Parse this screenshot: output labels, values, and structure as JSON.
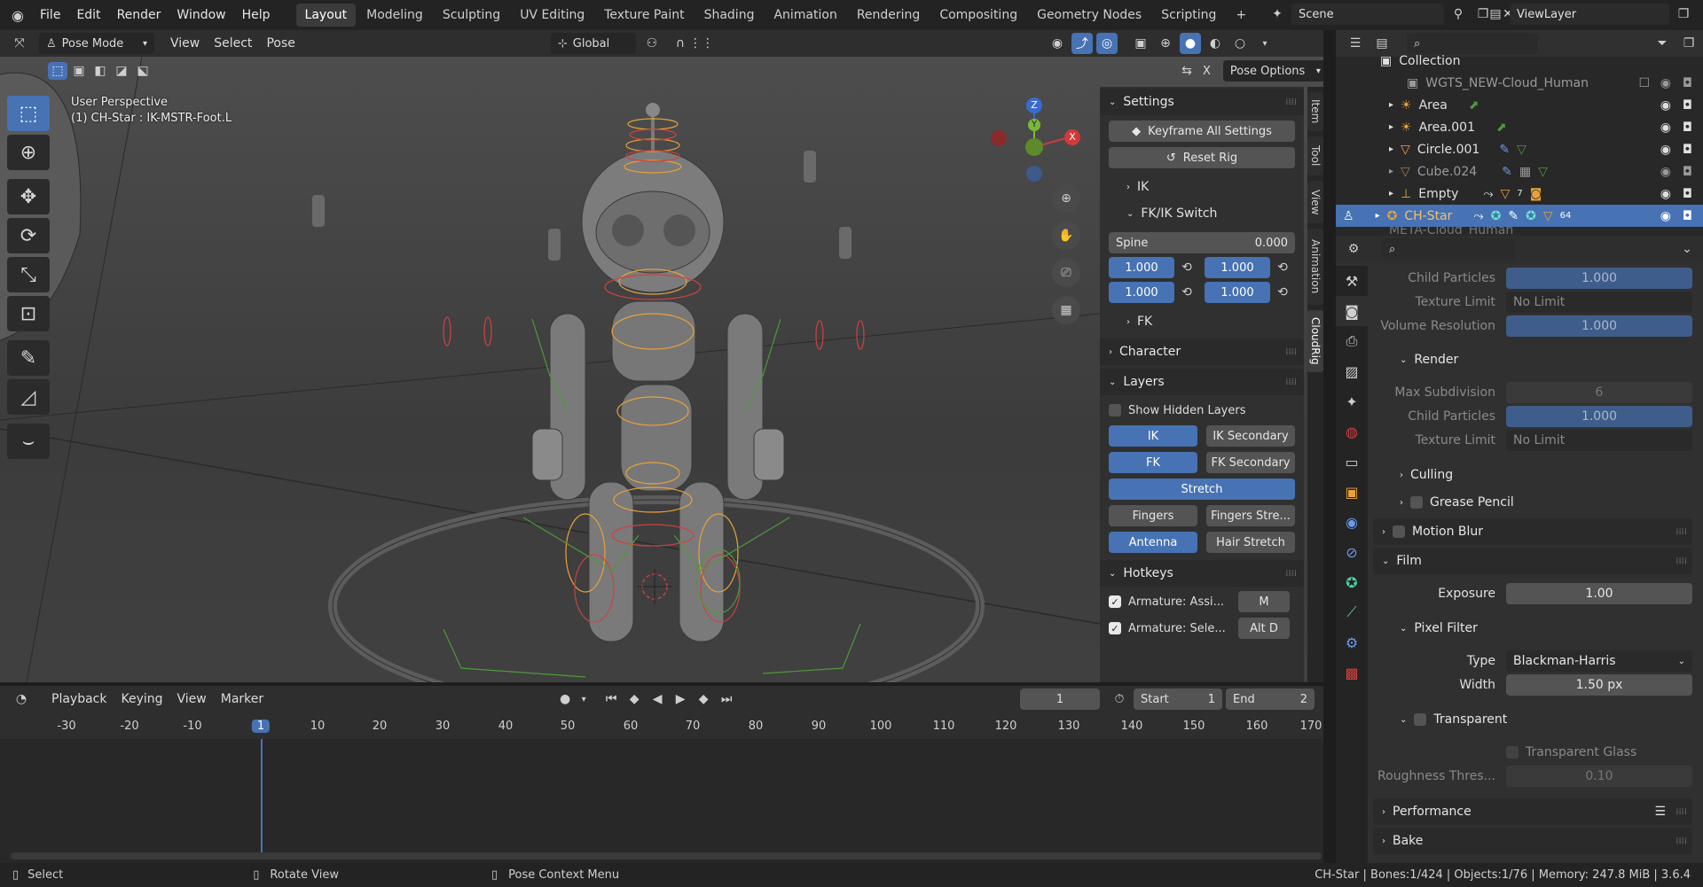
{
  "menu": [
    "File",
    "Edit",
    "Render",
    "Window",
    "Help"
  ],
  "workspaces": [
    "Layout",
    "Modeling",
    "Sculpting",
    "UV Editing",
    "Texture Paint",
    "Shading",
    "Animation",
    "Rendering",
    "Compositing",
    "Geometry Nodes",
    "Scripting"
  ],
  "active_workspace": "Layout",
  "scene": "Scene",
  "view_layer": "ViewLayer",
  "viewport_header": {
    "mode": "Pose Mode",
    "menus": [
      "View",
      "Select",
      "Pose"
    ],
    "orientation": "Global",
    "pose_options": "Pose Options",
    "x_label": "X"
  },
  "overlay_text": {
    "perspective": "User Perspective",
    "object": "(1) CH-Star : IK-MSTR-Foot.L"
  },
  "gizmo_axes": {
    "z": "Z",
    "y": "Y",
    "x": "X"
  },
  "npanel": {
    "settings_title": "Settings",
    "keyframe_all": "Keyframe All Settings",
    "reset_rig": "Reset Rig",
    "ik": "IK",
    "fkik_switch": "FK/IK Switch",
    "spine_label": "Spine",
    "spine_value": "0.000",
    "switch_values": [
      "1.000",
      "1.000",
      "1.000",
      "1.000"
    ],
    "fk": "FK",
    "character": "Character",
    "layers_title": "Layers",
    "show_hidden": "Show Hidden Layers",
    "layer_buttons": [
      {
        "label": "IK",
        "on": true
      },
      {
        "label": "IK Secondary",
        "on": false
      },
      {
        "label": "FK",
        "on": true
      },
      {
        "label": "FK Secondary",
        "on": false
      },
      {
        "label": "Stretch",
        "on": true
      },
      {
        "label": "Fingers",
        "on": false
      },
      {
        "label": "Fingers Stre...",
        "on": false
      },
      {
        "label": "Antenna",
        "on": true
      },
      {
        "label": "Hair Stretch",
        "on": false
      }
    ],
    "hotkeys_title": "Hotkeys",
    "hotkeys": [
      {
        "label": "Armature: Assi...",
        "key": "M"
      },
      {
        "label": "Armature: Sele...",
        "key": "Alt D"
      }
    ]
  },
  "vertical_tabs": [
    "Item",
    "Tool",
    "View",
    "Animation",
    "CloudRig"
  ],
  "timeline": {
    "menus": [
      "Playback",
      "Keying",
      "View",
      "Marker"
    ],
    "current_frame": "1",
    "start_label": "Start",
    "start": "1",
    "end_label": "End",
    "end": "2",
    "ticks": [
      "-30",
      "-20",
      "-10",
      "1",
      "10",
      "20",
      "30",
      "40",
      "50",
      "60",
      "70",
      "80",
      "90",
      "100",
      "110",
      "120",
      "130",
      "140",
      "150",
      "160",
      "170"
    ]
  },
  "outliner": {
    "rows": [
      {
        "name": "Collection",
        "icon": "collection-icon"
      },
      {
        "name": "WGTS_NEW-Cloud_Human",
        "icon": "collection-icon"
      },
      {
        "name": "Area",
        "icon": "light-icon"
      },
      {
        "name": "Area.001",
        "icon": "light-icon"
      },
      {
        "name": "Circle.001",
        "icon": "mesh-icon"
      },
      {
        "name": "Cube.024",
        "icon": "mesh-icon"
      },
      {
        "name": "Empty",
        "icon": "empty-icon"
      },
      {
        "name": "CH-Star",
        "icon": "armature-icon"
      },
      {
        "name": "META-Cloud_Human",
        "icon": "armature-icon"
      }
    ],
    "badge_7": "7",
    "badge_64": "64"
  },
  "properties": {
    "child_particles_1": "Child Particles",
    "child_particles_1_val": "1.000",
    "texture_limit_1": "Texture Limit",
    "texture_limit_1_val": "No Limit",
    "volume_resolution": "Volume Resolution",
    "volume_resolution_val": "1.000",
    "render": "Render",
    "max_subdivision": "Max Subdivision",
    "max_subdivision_val": "6",
    "child_particles_2": "Child Particles",
    "child_particles_2_val": "1.000",
    "texture_limit_2": "Texture Limit",
    "texture_limit_2_val": "No Limit",
    "culling": "Culling",
    "grease_pencil": "Grease Pencil",
    "motion_blur": "Motion Blur",
    "film": "Film",
    "exposure": "Exposure",
    "exposure_val": "1.00",
    "pixel_filter": "Pixel Filter",
    "type": "Type",
    "type_val": "Blackman-Harris",
    "width": "Width",
    "width_val": "1.50 px",
    "transparent": "Transparent",
    "transparent_glass": "Transparent Glass",
    "roughness": "Roughness Thres...",
    "roughness_val": "0.10",
    "performance": "Performance",
    "bake": "Bake"
  },
  "statusbar": {
    "select": "Select",
    "rotate": "Rotate View",
    "context": "Pose Context Menu",
    "stats": "CH-Star | Bones:1/424 | Objects:1/76 | Memory: 247.8 MiB | 3.6.4"
  },
  "colors": {
    "accent": "#4772b3",
    "orange": "#e8a23a",
    "green": "#4d9a3a"
  }
}
